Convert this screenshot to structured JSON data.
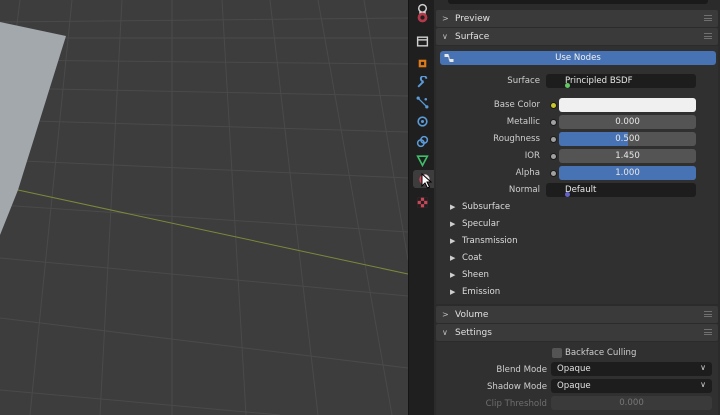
{
  "properties": {
    "panels": {
      "preview": "Preview",
      "surface": "Surface",
      "volume": "Volume",
      "settings": "Settings"
    },
    "surface": {
      "use_nodes_label": "Use Nodes",
      "surface_label": "Surface",
      "surface_value": "Principled BSDF",
      "fields": [
        {
          "label": "Base Color",
          "value": ""
        },
        {
          "label": "Metallic",
          "value": "0.000"
        },
        {
          "label": "Roughness",
          "value": "0.500",
          "fraction": 0.5
        },
        {
          "label": "IOR",
          "value": "1.450"
        },
        {
          "label": "Alpha",
          "value": "1.000",
          "fraction": 1.0
        }
      ],
      "normal_label": "Normal",
      "normal_value": "Default",
      "subpanels": [
        "Subsurface",
        "Specular",
        "Transmission",
        "Coat",
        "Sheen",
        "Emission"
      ]
    },
    "settings": {
      "backface_culling": "Backface Culling",
      "blend_mode_label": "Blend Mode",
      "blend_mode_value": "Opaque",
      "shadow_mode_label": "Shadow Mode",
      "shadow_mode_value": "Opaque",
      "clip_threshold_label": "Clip Threshold",
      "clip_threshold_value": "0.000"
    }
  },
  "colors": {
    "accent": "#4772b3",
    "base_color": "#f0f0f0"
  },
  "tabs": [
    "scene-icon",
    "world-icon",
    "collection-icon",
    "object-icon",
    "modifier-icon",
    "particles-icon",
    "physics-icon",
    "constraints-icon",
    "object-data-icon",
    "material-icon",
    "texture-icon"
  ]
}
